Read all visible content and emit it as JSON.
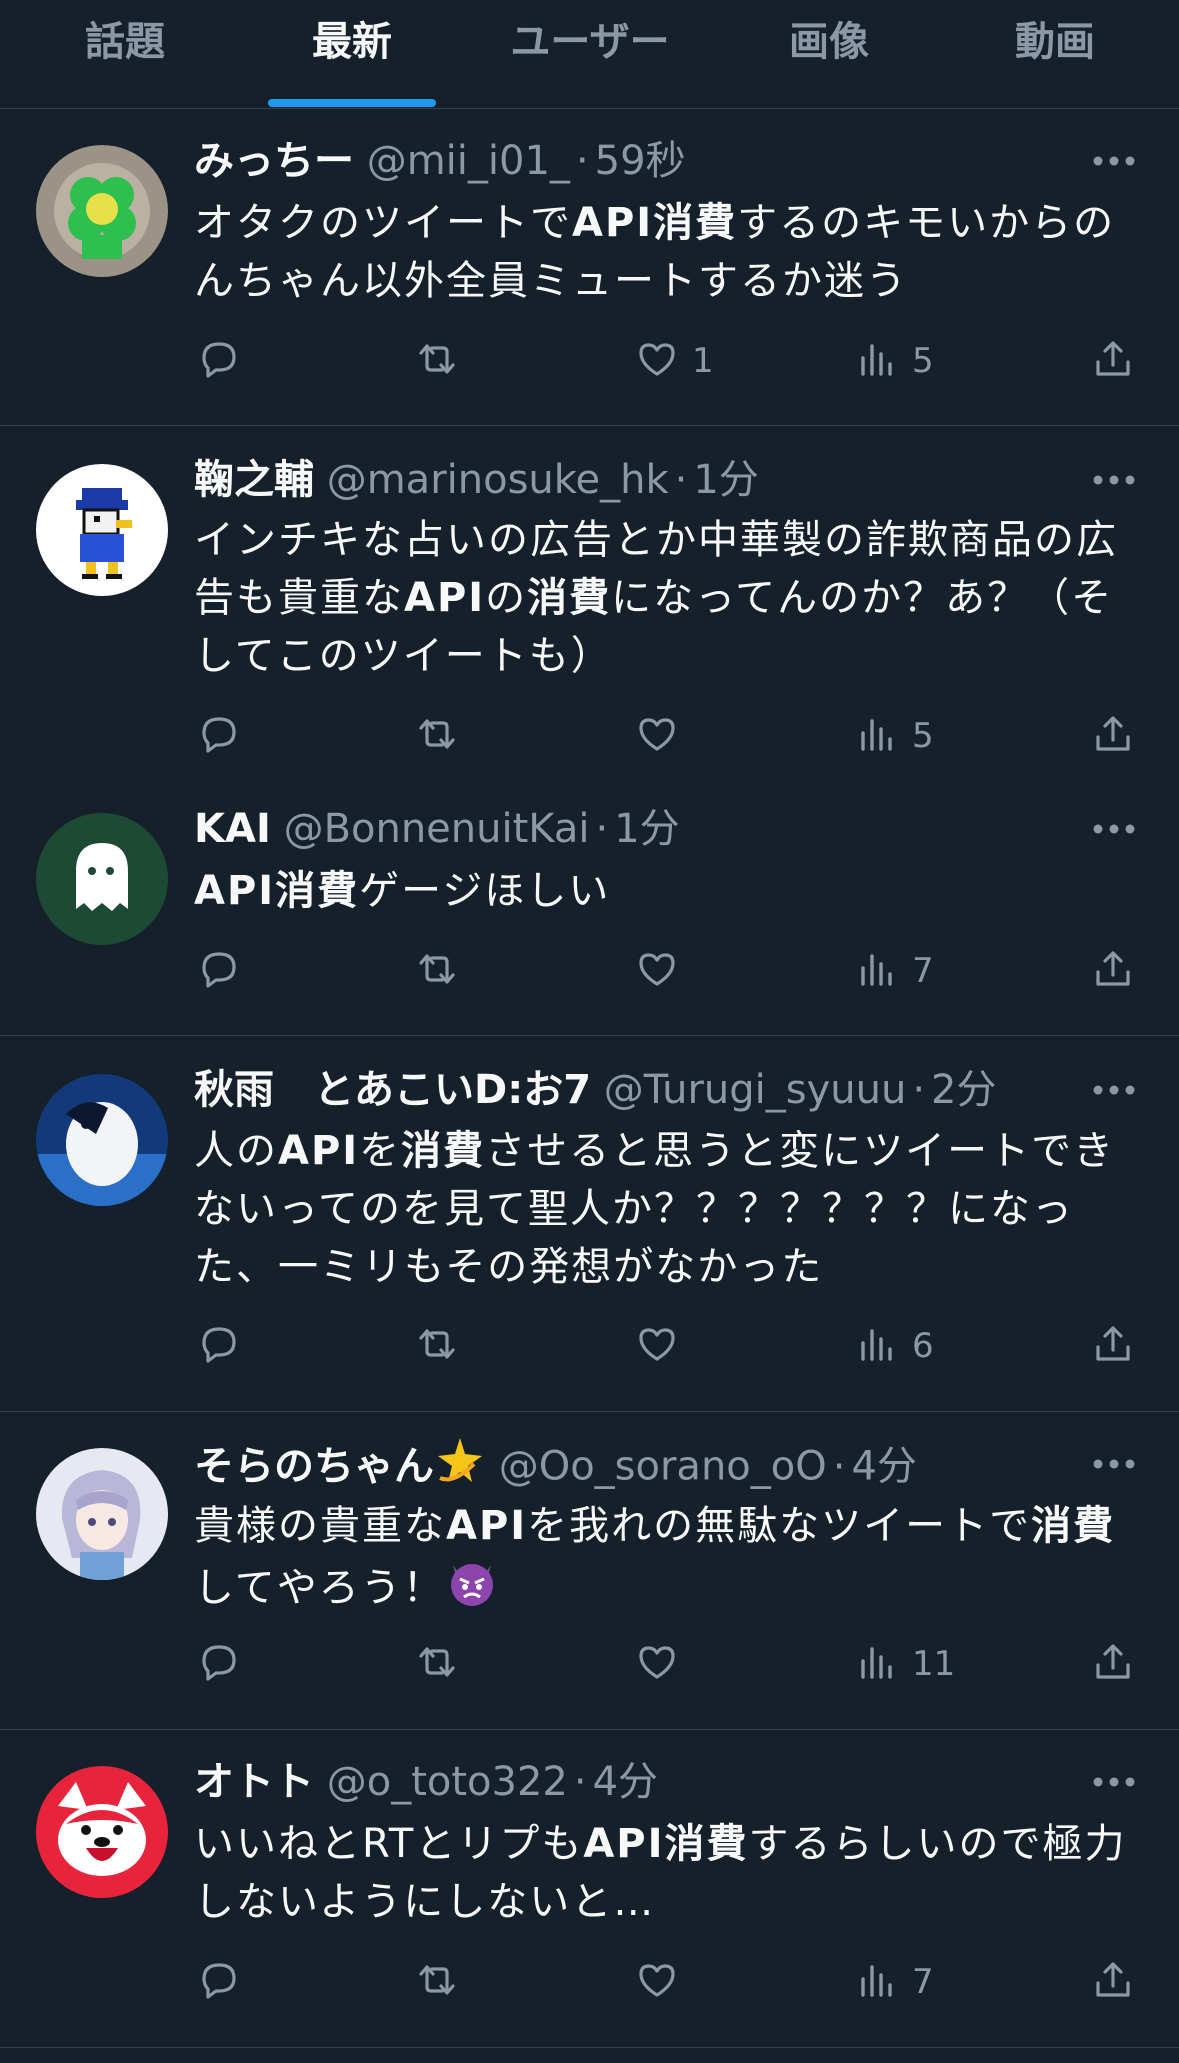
{
  "tabs": [
    {
      "label": "話題",
      "active": false
    },
    {
      "label": "最新",
      "active": true
    },
    {
      "label": "ユーザー",
      "active": false
    },
    {
      "label": "画像",
      "active": false
    },
    {
      "label": "動画",
      "active": false
    }
  ],
  "accent_color": "#1d9bf0",
  "tweets": [
    {
      "name": "みっちー",
      "handle": "@mii_i01_",
      "dot": "·",
      "time": "59秒",
      "segments": [
        {
          "t": "オタクのツイートで"
        },
        {
          "t": "API消費",
          "b": true
        },
        {
          "t": "するのキモいからのんちゃん以外全員ミュートするか迷う"
        }
      ],
      "likes": "1",
      "views": "5"
    },
    {
      "name": "鞠之輔",
      "handle": "@marinosuke_hk",
      "dot": "·",
      "time": "1分",
      "segments": [
        {
          "t": "インチキな占いの広告とか中華製の詐欺商品の広告も貴重な"
        },
        {
          "t": "API",
          "b": true
        },
        {
          "t": "の"
        },
        {
          "t": "消費",
          "b": true
        },
        {
          "t": "になってんのか？あ？（そしてこのツイートも）"
        }
      ],
      "likes": "",
      "views": "5"
    },
    {
      "name": "KAI",
      "handle": "@BonnenuitKai",
      "dot": "·",
      "time": "1分",
      "segments": [
        {
          "t": "API消費",
          "b": true
        },
        {
          "t": "ゲージほしい"
        }
      ],
      "likes": "",
      "views": "7"
    },
    {
      "name": "秋雨　とあこいD:お7",
      "handle": "@Turugi_syuuu",
      "dot": "·",
      "time": "2分",
      "segments": [
        {
          "t": "人の"
        },
        {
          "t": "API",
          "b": true
        },
        {
          "t": "を"
        },
        {
          "t": "消費",
          "b": true
        },
        {
          "t": "させると思うと変にツイートできないってのを見て聖人か？？？？？？？になった、一ミリもその発想がなかった"
        }
      ],
      "likes": "",
      "views": "6"
    },
    {
      "name": "そらのちゃん",
      "name_emoji": "dizzy-emoji",
      "handle": "@Oo_sorano_oO",
      "dot": "·",
      "time": "4分",
      "segments": [
        {
          "t": "貴様の貴重な"
        },
        {
          "t": "API",
          "b": true
        },
        {
          "t": "を我れの無駄なツイートで"
        },
        {
          "t": "消費",
          "b": true
        },
        {
          "t": "してやろう！"
        }
      ],
      "body_emoji": "angry-devil-emoji",
      "likes": "",
      "views": "11"
    },
    {
      "name": "オトト",
      "handle": "@o_toto322",
      "dot": "·",
      "time": "4分",
      "segments": [
        {
          "t": "いいねとRTとリプも"
        },
        {
          "t": "API消費",
          "b": true
        },
        {
          "t": "するらしいので極力しないようにしないと…"
        }
      ],
      "likes": "",
      "views": "7"
    }
  ]
}
